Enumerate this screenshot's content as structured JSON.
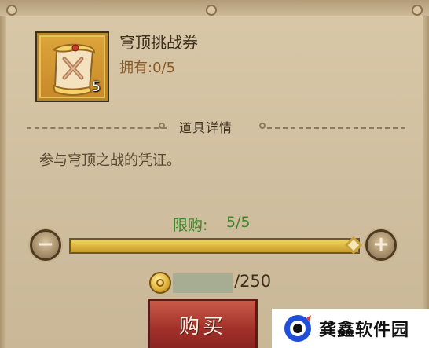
{
  "item": {
    "name": "穹顶挑战券",
    "owned": "拥有:0/5",
    "count": "5",
    "icon": "scroll-ticket-icon"
  },
  "details": {
    "title": "道具详情",
    "description": "参与穹顶之战的凭证。"
  },
  "purchase": {
    "limit_label": "限购:",
    "limit_value": "5/5",
    "quantity_fraction": 1.0,
    "minus_label": "−",
    "plus_label": "+",
    "cost_value": "/250",
    "buy_label": "购买"
  },
  "watermark": {
    "text": "龚鑫软件园"
  },
  "colors": {
    "limit_green": "#3c8a2a",
    "buy_red": "#a2302a",
    "item_gold": "#dca43a"
  }
}
